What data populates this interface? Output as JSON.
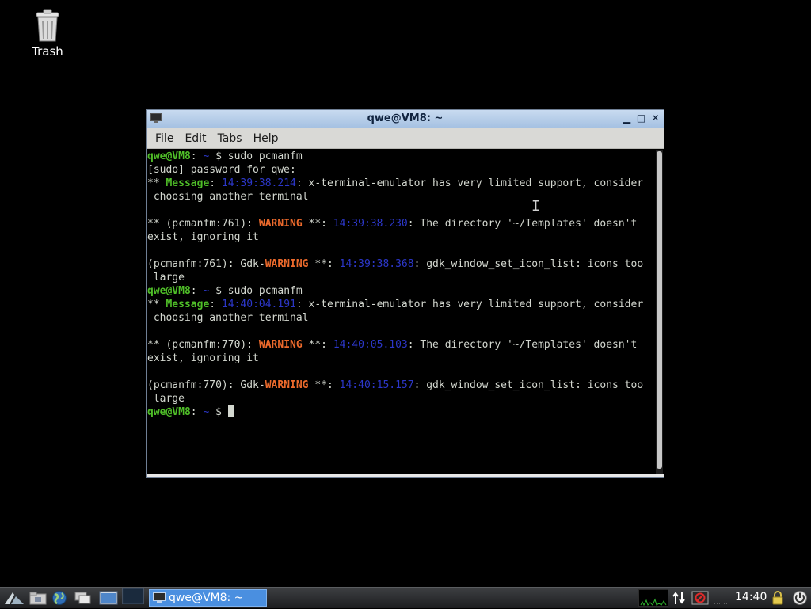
{
  "desktop": {
    "icons": [
      {
        "label": "Trash",
        "icon": "trash-icon"
      }
    ]
  },
  "window": {
    "title": "qwe@VM8: ~",
    "menu": [
      "File",
      "Edit",
      "Tabs",
      "Help"
    ],
    "controls": {
      "minimize": "minimize-icon",
      "maximize": "maximize-icon",
      "close": "close-icon"
    },
    "lines": [
      [
        {
          "t": "qwe@VM8",
          "c": "gbold"
        },
        {
          "t": ": ",
          "c": ""
        },
        {
          "t": "~",
          "c": "blue"
        },
        {
          "t": " $ sudo pcmanfm",
          "c": ""
        }
      ],
      [
        {
          "t": "[sudo] password for qwe:",
          "c": ""
        }
      ],
      [
        {
          "t": "** ",
          "c": ""
        },
        {
          "t": "Message",
          "c": "gbold"
        },
        {
          "t": ": ",
          "c": ""
        },
        {
          "t": "14:39:38.214",
          "c": "blue"
        },
        {
          "t": ": x-terminal-emulator has very limited support, consider",
          "c": ""
        }
      ],
      [
        {
          "t": " choosing another terminal",
          "c": ""
        }
      ],
      [],
      [
        {
          "t": "** (pcmanfm:761): ",
          "c": ""
        },
        {
          "t": "WARNING",
          "c": "warn"
        },
        {
          "t": " **: ",
          "c": ""
        },
        {
          "t": "14:39:38.230",
          "c": "blue"
        },
        {
          "t": ": The directory '~/Templates' doesn't",
          "c": ""
        }
      ],
      [
        {
          "t": "exist, ignoring it",
          "c": ""
        }
      ],
      [],
      [
        {
          "t": "(pcmanfm:761): Gdk-",
          "c": ""
        },
        {
          "t": "WARNING",
          "c": "warn"
        },
        {
          "t": " **: ",
          "c": ""
        },
        {
          "t": "14:39:38.368",
          "c": "blue"
        },
        {
          "t": ": gdk_window_set_icon_list: icons too",
          "c": ""
        }
      ],
      [
        {
          "t": " large",
          "c": ""
        }
      ],
      [
        {
          "t": "qwe@VM8",
          "c": "gbold"
        },
        {
          "t": ": ",
          "c": ""
        },
        {
          "t": "~",
          "c": "blue"
        },
        {
          "t": " $ sudo pcmanfm",
          "c": ""
        }
      ],
      [
        {
          "t": "** ",
          "c": ""
        },
        {
          "t": "Message",
          "c": "gbold"
        },
        {
          "t": ": ",
          "c": ""
        },
        {
          "t": "14:40:04.191",
          "c": "blue"
        },
        {
          "t": ": x-terminal-emulator has very limited support, consider",
          "c": ""
        }
      ],
      [
        {
          "t": " choosing another terminal",
          "c": ""
        }
      ],
      [],
      [
        {
          "t": "** (pcmanfm:770): ",
          "c": ""
        },
        {
          "t": "WARNING",
          "c": "warn"
        },
        {
          "t": " **: ",
          "c": ""
        },
        {
          "t": "14:40:05.103",
          "c": "blue"
        },
        {
          "t": ": The directory '~/Templates' doesn't",
          "c": ""
        }
      ],
      [
        {
          "t": "exist, ignoring it",
          "c": ""
        }
      ],
      [],
      [
        {
          "t": "(pcmanfm:770): Gdk-",
          "c": ""
        },
        {
          "t": "WARNING",
          "c": "warn"
        },
        {
          "t": " **: ",
          "c": ""
        },
        {
          "t": "14:40:15.157",
          "c": "blue"
        },
        {
          "t": ": gdk_window_set_icon_list: icons too",
          "c": ""
        }
      ],
      [
        {
          "t": " large",
          "c": ""
        }
      ],
      [
        {
          "t": "qwe@VM8",
          "c": "gbold"
        },
        {
          "t": ": ",
          "c": ""
        },
        {
          "t": "~",
          "c": "blue"
        },
        {
          "t": " $ ",
          "c": ""
        }
      ]
    ]
  },
  "taskbar": {
    "launchers": [
      "menu-icon",
      "file-manager-icon",
      "browser-icon",
      "window-switcher-icon",
      "desktop-icon",
      "workspace-icon"
    ],
    "task_button": {
      "label": "qwe@VM8: ~",
      "icon": "terminal-icon"
    },
    "tray": [
      "network-graph-icon",
      "network-icon",
      "volume-mute-icon"
    ],
    "clock": "14:40",
    "right_icons": [
      "lock-icon",
      "power-icon"
    ]
  }
}
